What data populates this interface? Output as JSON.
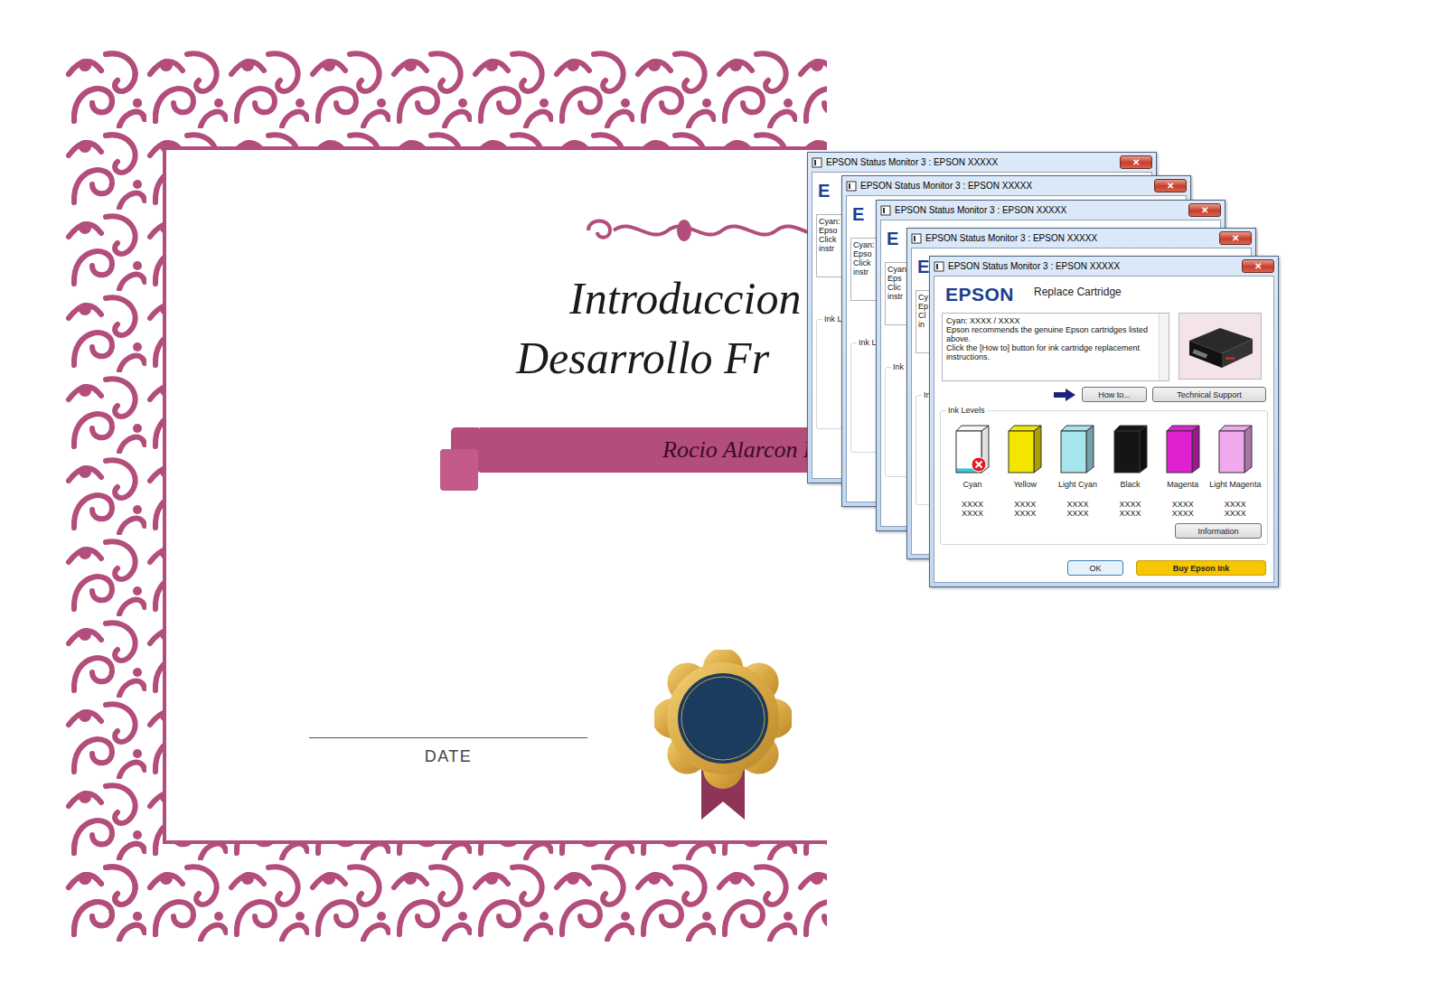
{
  "certificate": {
    "title_lines": [
      "Introduccion",
      "Desarrollo Fr"
    ],
    "name": "Rocio Alarcon P",
    "date_label": "DATE"
  },
  "windows": [
    {
      "kind": "back",
      "title": "EPSON Status Monitor 3 : EPSON XXXXX",
      "close": "✕",
      "logo": "E",
      "message_lines": [
        "Cyan:",
        "Epso",
        "Click",
        "instr"
      ],
      "ink_label": "Ink L"
    },
    {
      "kind": "back",
      "title": "EPSON Status Monitor 3 : EPSON XXXXX",
      "close": "✕",
      "logo": "E",
      "message_lines": [
        "Cyan:",
        "Epso",
        "Click",
        "instr"
      ],
      "ink_label": "Ink L"
    },
    {
      "kind": "back",
      "title": "EPSON Status Monitor 3 : EPSON XXXXX",
      "close": "✕",
      "logo": "E",
      "message_lines": [
        "Cyan",
        "Eps",
        "Clic",
        "instr"
      ],
      "ink_label": "Ink L"
    },
    {
      "kind": "back",
      "title": "EPSON Status Monitor 3 : EPSON XXXXX",
      "close": "✕",
      "logo": "E",
      "message_lines": [
        "Cy",
        "Ep",
        "Cl",
        "in"
      ],
      "ink_label": "In"
    },
    {
      "kind": "full",
      "title": "EPSON Status Monitor 3 : EPSON XXXXX",
      "close": "✕",
      "logo": "EPSON",
      "heading": "Replace Cartridge",
      "message": {
        "heading": "Cyan: XXXX / XXXX",
        "lines": [
          "Epson recommends the genuine Epson cartridges listed above.",
          "Click the [How to] button for ink cartridge replacement instructions."
        ]
      },
      "buttons": {
        "how_to": "How to...",
        "support": "Technical Support",
        "information": "Information",
        "ok": "OK",
        "buy": "Buy Epson Ink"
      },
      "ink_label": "Ink Levels",
      "inks": [
        {
          "name": "Cyan",
          "values": [
            "XXXX",
            "XXXX"
          ],
          "level": 0.1,
          "empty": true,
          "color": "#3fc6dc"
        },
        {
          "name": "Yellow",
          "values": [
            "XXXX",
            "XXXX"
          ],
          "level": 1,
          "empty": false,
          "color": "#f2e600"
        },
        {
          "name": "Light Cyan",
          "values": [
            "XXXX",
            "XXXX"
          ],
          "level": 1,
          "empty": false,
          "color": "#a6e4ee"
        },
        {
          "name": "Black",
          "values": [
            "XXXX",
            "XXXX"
          ],
          "level": 1,
          "empty": false,
          "color": "#151515"
        },
        {
          "name": "Magenta",
          "values": [
            "XXXX",
            "XXXX"
          ],
          "level": 1,
          "empty": false,
          "color": "#e021d2"
        },
        {
          "name": "Light Magenta",
          "values": [
            "XXXX",
            "XXXX"
          ],
          "level": 1,
          "empty": false,
          "color": "#f1a9ee"
        }
      ]
    }
  ]
}
